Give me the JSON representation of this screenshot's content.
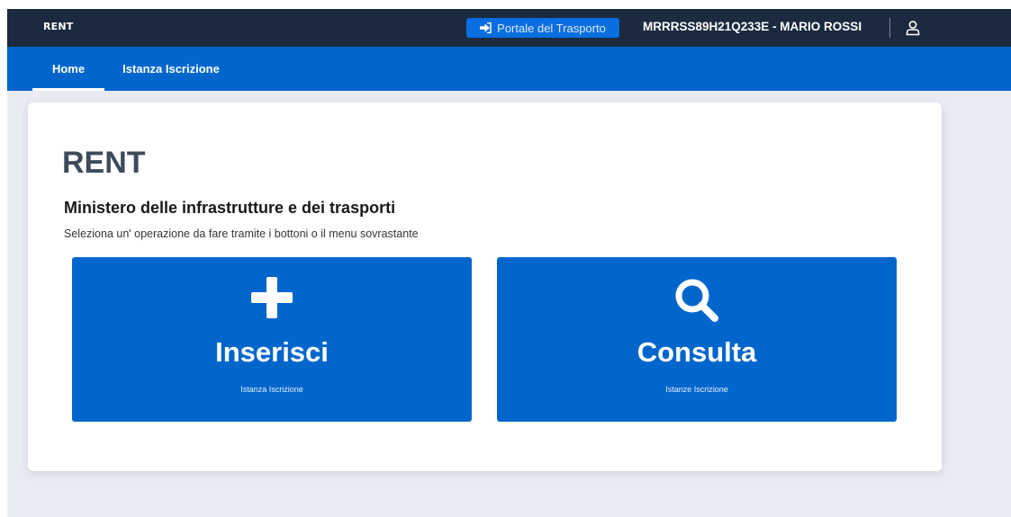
{
  "header": {
    "brand": "RENT",
    "portal_button": {
      "label": "Portale del Trasporto",
      "icon": "sign-in-icon"
    },
    "user": "MRRRSS89H21Q233E - MARIO ROSSI",
    "user_icon": "user-icon"
  },
  "nav": {
    "tabs": [
      {
        "label": "Home",
        "active": true
      },
      {
        "label": "Istanza Iscrizione",
        "active": false
      }
    ]
  },
  "main": {
    "title": "RENT",
    "subtitle": "Ministero delle infrastrutture e dei trasporti",
    "instruction": "Seleziona un' operazione da fare tramite i bottoni o il menu sovrastante",
    "actions": [
      {
        "label": "Inserisci",
        "sublabel": "Istanza Iscrizione",
        "icon": "plus-icon"
      },
      {
        "label": "Consulta",
        "sublabel": "Istanze Iscrizione",
        "icon": "search-icon"
      }
    ]
  },
  "colors": {
    "topbar": "#1b2a3e",
    "primary": "#0066cc",
    "background": "#e8ecf2",
    "title": "#3d4a5c"
  }
}
